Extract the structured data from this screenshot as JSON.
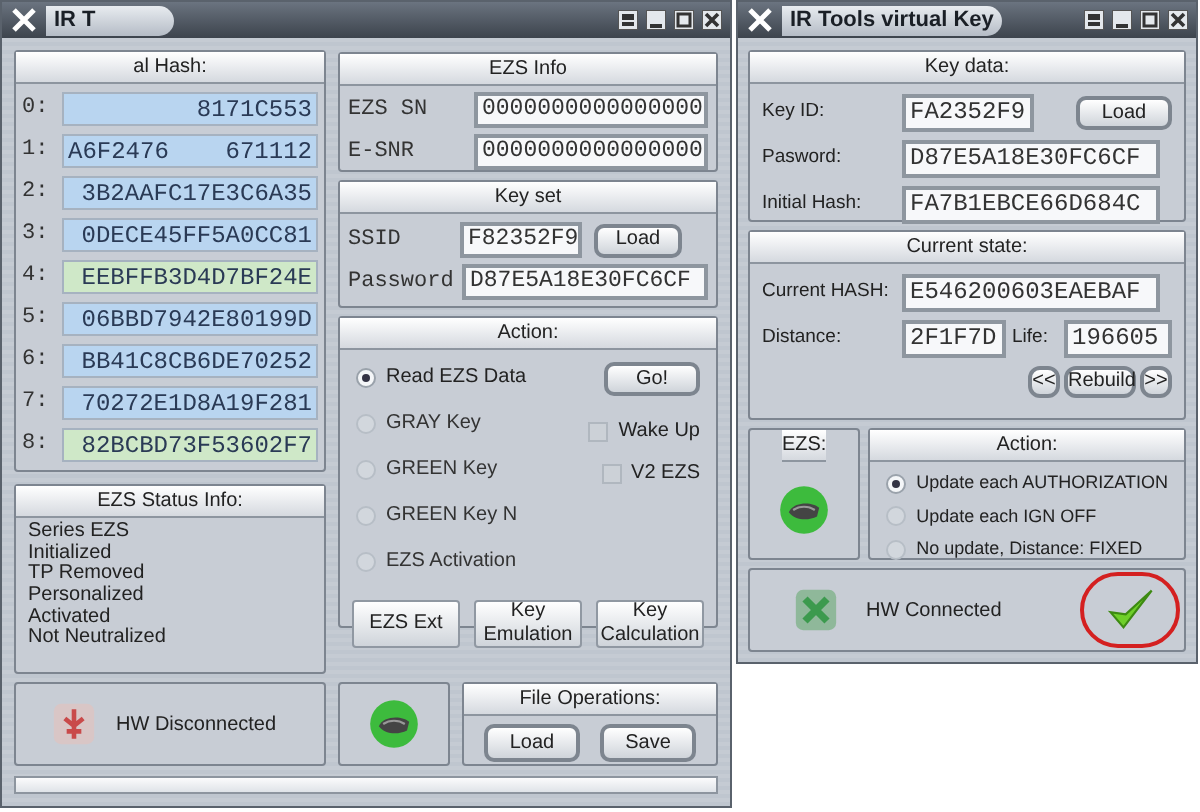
{
  "left_window": {
    "title": "IR T",
    "hash_panel": {
      "header": "al Hash:",
      "rows": [
        {
          "index": "0:",
          "value_parts": [
            "8171C553"
          ],
          "color": "#b9d5f0"
        },
        {
          "index": "1:",
          "value_parts": [
            "A6F2476",
            "671112"
          ],
          "color": "#b9d5f0"
        },
        {
          "index": "2:",
          "value_parts": [
            "3B2AAFC17E3C6A35"
          ],
          "color": "#b9d5f0"
        },
        {
          "index": "3:",
          "value_parts": [
            "0DECE45FF5A0CC81"
          ],
          "color": "#b9d5f0"
        },
        {
          "index": "4:",
          "value_parts": [
            "EEBFFB3D4D7BF24E"
          ],
          "color": "#cfe8c8"
        },
        {
          "index": "5:",
          "value_parts": [
            "06BBD7942E80199D"
          ],
          "color": "#b9d5f0"
        },
        {
          "index": "6:",
          "value_parts": [
            "BB41C8CB6DE70252"
          ],
          "color": "#b9d5f0"
        },
        {
          "index": "7:",
          "value_parts": [
            "70272E1D8A19F281"
          ],
          "color": "#b9d5f0"
        },
        {
          "index": "8:",
          "value_parts": [
            "82BCBD73F53602F7"
          ],
          "color": "#cfe8c8"
        }
      ]
    },
    "status_panel": {
      "header": "EZS Status Info:",
      "lines": [
        "Series EZS",
        "Initialized",
        "TP Removed",
        "Personalized",
        "Activated",
        "Not Neutralized"
      ]
    },
    "hw_status": {
      "text": "HW Disconnected",
      "connected": false
    },
    "ezs_info": {
      "header": "EZS Info",
      "fields": [
        {
          "label": "EZS SN",
          "value": "0000000000000000"
        },
        {
          "label": "E-SNR",
          "value": "0000000000000000"
        }
      ]
    },
    "key_set": {
      "header": "Key set",
      "ssid": {
        "label": "SSID",
        "value": "F82352F9"
      },
      "load_button": "Load",
      "password": {
        "label": "Password",
        "value": "D87E5A18E30FC6CF"
      }
    },
    "action": {
      "header": "Action:",
      "options": [
        {
          "label": "Read EZS Data",
          "selected": true
        },
        {
          "label": "GRAY Key",
          "selected": false
        },
        {
          "label": "GREEN Key",
          "selected": false
        },
        {
          "label": "GREEN Key N",
          "selected": false
        },
        {
          "label": "EZS Activation",
          "selected": false
        }
      ],
      "go_button": "Go!",
      "checkboxes": [
        {
          "label": "Wake Up",
          "checked": false
        },
        {
          "label": "V2 EZS",
          "checked": false
        }
      ],
      "buttons": [
        [
          "EZS Ext"
        ],
        [
          "Key",
          "Emulation"
        ],
        [
          "Key",
          "Calculation"
        ]
      ]
    },
    "file_operations": {
      "header": "File Operations:",
      "buttons": [
        "Load",
        "Save"
      ]
    },
    "progress": {
      "level": 0
    }
  },
  "right_window": {
    "title": "IR Tools virtual Key",
    "key_data": {
      "header": "Key data:",
      "load_button": "Load",
      "fields": [
        {
          "label": "Key ID:",
          "value": "FA2352F9"
        },
        {
          "label": "Pasword:",
          "value": "D87E5A18E30FC6CF"
        },
        {
          "label": "Initial Hash:",
          "value": "FA7B1EBCE66D684C"
        }
      ]
    },
    "current_state": {
      "header": "Current state:",
      "current_hash": {
        "label": "Current HASH:",
        "value": "E546200603EAEBAF"
      },
      "distance": {
        "label": "Distance:",
        "value": "2F1F7D"
      },
      "life": {
        "label": "Life:",
        "value": "196605"
      },
      "nav_buttons": [
        "<<",
        "Rebuild",
        ">>"
      ]
    },
    "ezs": {
      "header": "EZS:"
    },
    "action": {
      "header": "Action:",
      "options": [
        {
          "label": "Update each AUTHORIZATION",
          "selected": true
        },
        {
          "label": "Update each IGN OFF",
          "selected": false
        },
        {
          "label": "No update, Distance: FIXED",
          "selected": false
        }
      ]
    },
    "hw_status": {
      "text": "HW Connected",
      "connected": true
    }
  }
}
